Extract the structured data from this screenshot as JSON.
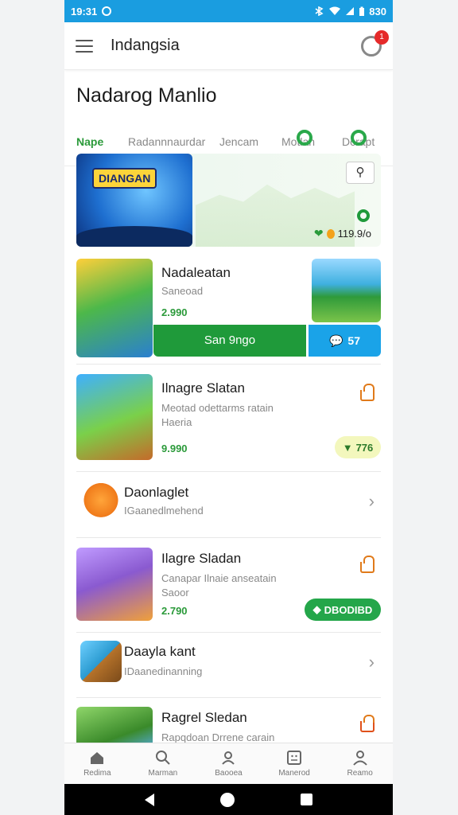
{
  "status_bar": {
    "time": "19:31",
    "right_text": "830"
  },
  "app_bar": {
    "title": "Indangsia",
    "notification_count": "1"
  },
  "section": {
    "title": "Nadarog Manlio",
    "tabs": [
      {
        "label": "Nape",
        "active": true
      },
      {
        "label": "Radannnaurdar",
        "active": false
      },
      {
        "label": "Jencam",
        "active": false
      },
      {
        "label": "Motlan",
        "active": false
      },
      {
        "label": "Dcrapt",
        "active": false
      }
    ]
  },
  "featured": {
    "logo_text": "DIANGAN",
    "price": "119.9/o",
    "search_icon": "search-icon"
  },
  "cards": [
    {
      "title": "Nadaleatan",
      "subtitle": "Saneoad",
      "price": "2.990",
      "install_label": "San 9ngo",
      "side_label": "57"
    },
    {
      "title": "Ilnagre Slatan",
      "subtitle_1": "Meotad odettarms ratain",
      "subtitle_2": "Haeria",
      "price": "9.990",
      "pill": "776"
    },
    {
      "title": "Daonlaglet",
      "subtitle": "IGaanedlmehend"
    },
    {
      "title": "Ilagre Sladan",
      "subtitle_1": "Canapar Ilnaie anseatain",
      "subtitle_2": "Saoor",
      "price": "2.790",
      "pill": "DBODIBD"
    },
    {
      "title": "Daayla kant",
      "subtitle": "IDaanedinanning"
    },
    {
      "title": "Ragrel Sledan",
      "subtitle": "Rapqdoan Drrene carain"
    }
  ],
  "bottom_nav": [
    {
      "label": "Redima",
      "icon": "home-icon"
    },
    {
      "label": "Marman",
      "icon": "search-icon"
    },
    {
      "label": "Baooea",
      "icon": "people-icon"
    },
    {
      "label": "Manerod",
      "icon": "grid-icon"
    },
    {
      "label": "Reamo",
      "icon": "profile-icon"
    }
  ],
  "colors": {
    "status_bar": "#1a9de0",
    "accent_green": "#1f9a3a",
    "accent_blue": "#1aa3e8",
    "orange": "#e07a1a"
  }
}
